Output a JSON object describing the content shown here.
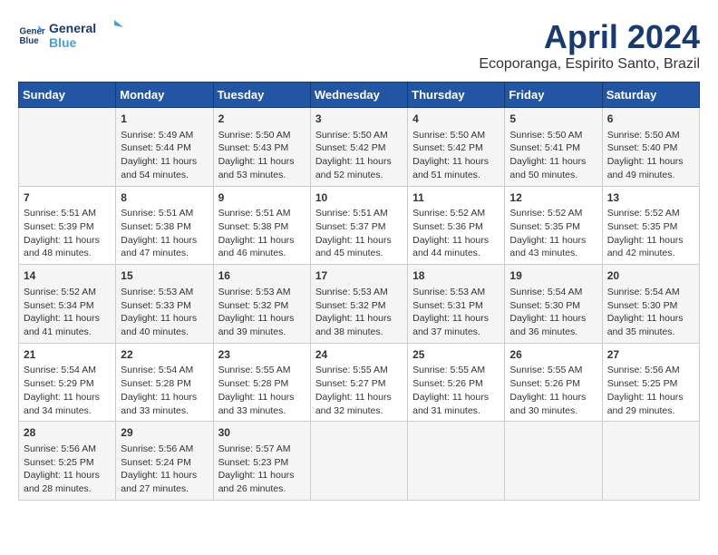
{
  "logo": {
    "line1": "General",
    "line2": "Blue"
  },
  "title": "April 2024",
  "location": "Ecoporanga, Espirito Santo, Brazil",
  "days_of_week": [
    "Sunday",
    "Monday",
    "Tuesday",
    "Wednesday",
    "Thursday",
    "Friday",
    "Saturday"
  ],
  "weeks": [
    [
      {
        "day": "",
        "content": ""
      },
      {
        "day": "1",
        "content": "Sunrise: 5:49 AM\nSunset: 5:44 PM\nDaylight: 11 hours\nand 54 minutes."
      },
      {
        "day": "2",
        "content": "Sunrise: 5:50 AM\nSunset: 5:43 PM\nDaylight: 11 hours\nand 53 minutes."
      },
      {
        "day": "3",
        "content": "Sunrise: 5:50 AM\nSunset: 5:42 PM\nDaylight: 11 hours\nand 52 minutes."
      },
      {
        "day": "4",
        "content": "Sunrise: 5:50 AM\nSunset: 5:42 PM\nDaylight: 11 hours\nand 51 minutes."
      },
      {
        "day": "5",
        "content": "Sunrise: 5:50 AM\nSunset: 5:41 PM\nDaylight: 11 hours\nand 50 minutes."
      },
      {
        "day": "6",
        "content": "Sunrise: 5:50 AM\nSunset: 5:40 PM\nDaylight: 11 hours\nand 49 minutes."
      }
    ],
    [
      {
        "day": "7",
        "content": "Sunrise: 5:51 AM\nSunset: 5:39 PM\nDaylight: 11 hours\nand 48 minutes."
      },
      {
        "day": "8",
        "content": "Sunrise: 5:51 AM\nSunset: 5:38 PM\nDaylight: 11 hours\nand 47 minutes."
      },
      {
        "day": "9",
        "content": "Sunrise: 5:51 AM\nSunset: 5:38 PM\nDaylight: 11 hours\nand 46 minutes."
      },
      {
        "day": "10",
        "content": "Sunrise: 5:51 AM\nSunset: 5:37 PM\nDaylight: 11 hours\nand 45 minutes."
      },
      {
        "day": "11",
        "content": "Sunrise: 5:52 AM\nSunset: 5:36 PM\nDaylight: 11 hours\nand 44 minutes."
      },
      {
        "day": "12",
        "content": "Sunrise: 5:52 AM\nSunset: 5:35 PM\nDaylight: 11 hours\nand 43 minutes."
      },
      {
        "day": "13",
        "content": "Sunrise: 5:52 AM\nSunset: 5:35 PM\nDaylight: 11 hours\nand 42 minutes."
      }
    ],
    [
      {
        "day": "14",
        "content": "Sunrise: 5:52 AM\nSunset: 5:34 PM\nDaylight: 11 hours\nand 41 minutes."
      },
      {
        "day": "15",
        "content": "Sunrise: 5:53 AM\nSunset: 5:33 PM\nDaylight: 11 hours\nand 40 minutes."
      },
      {
        "day": "16",
        "content": "Sunrise: 5:53 AM\nSunset: 5:32 PM\nDaylight: 11 hours\nand 39 minutes."
      },
      {
        "day": "17",
        "content": "Sunrise: 5:53 AM\nSunset: 5:32 PM\nDaylight: 11 hours\nand 38 minutes."
      },
      {
        "day": "18",
        "content": "Sunrise: 5:53 AM\nSunset: 5:31 PM\nDaylight: 11 hours\nand 37 minutes."
      },
      {
        "day": "19",
        "content": "Sunrise: 5:54 AM\nSunset: 5:30 PM\nDaylight: 11 hours\nand 36 minutes."
      },
      {
        "day": "20",
        "content": "Sunrise: 5:54 AM\nSunset: 5:30 PM\nDaylight: 11 hours\nand 35 minutes."
      }
    ],
    [
      {
        "day": "21",
        "content": "Sunrise: 5:54 AM\nSunset: 5:29 PM\nDaylight: 11 hours\nand 34 minutes."
      },
      {
        "day": "22",
        "content": "Sunrise: 5:54 AM\nSunset: 5:28 PM\nDaylight: 11 hours\nand 33 minutes."
      },
      {
        "day": "23",
        "content": "Sunrise: 5:55 AM\nSunset: 5:28 PM\nDaylight: 11 hours\nand 33 minutes."
      },
      {
        "day": "24",
        "content": "Sunrise: 5:55 AM\nSunset: 5:27 PM\nDaylight: 11 hours\nand 32 minutes."
      },
      {
        "day": "25",
        "content": "Sunrise: 5:55 AM\nSunset: 5:26 PM\nDaylight: 11 hours\nand 31 minutes."
      },
      {
        "day": "26",
        "content": "Sunrise: 5:55 AM\nSunset: 5:26 PM\nDaylight: 11 hours\nand 30 minutes."
      },
      {
        "day": "27",
        "content": "Sunrise: 5:56 AM\nSunset: 5:25 PM\nDaylight: 11 hours\nand 29 minutes."
      }
    ],
    [
      {
        "day": "28",
        "content": "Sunrise: 5:56 AM\nSunset: 5:25 PM\nDaylight: 11 hours\nand 28 minutes."
      },
      {
        "day": "29",
        "content": "Sunrise: 5:56 AM\nSunset: 5:24 PM\nDaylight: 11 hours\nand 27 minutes."
      },
      {
        "day": "30",
        "content": "Sunrise: 5:57 AM\nSunset: 5:23 PM\nDaylight: 11 hours\nand 26 minutes."
      },
      {
        "day": "",
        "content": ""
      },
      {
        "day": "",
        "content": ""
      },
      {
        "day": "",
        "content": ""
      },
      {
        "day": "",
        "content": ""
      }
    ]
  ]
}
